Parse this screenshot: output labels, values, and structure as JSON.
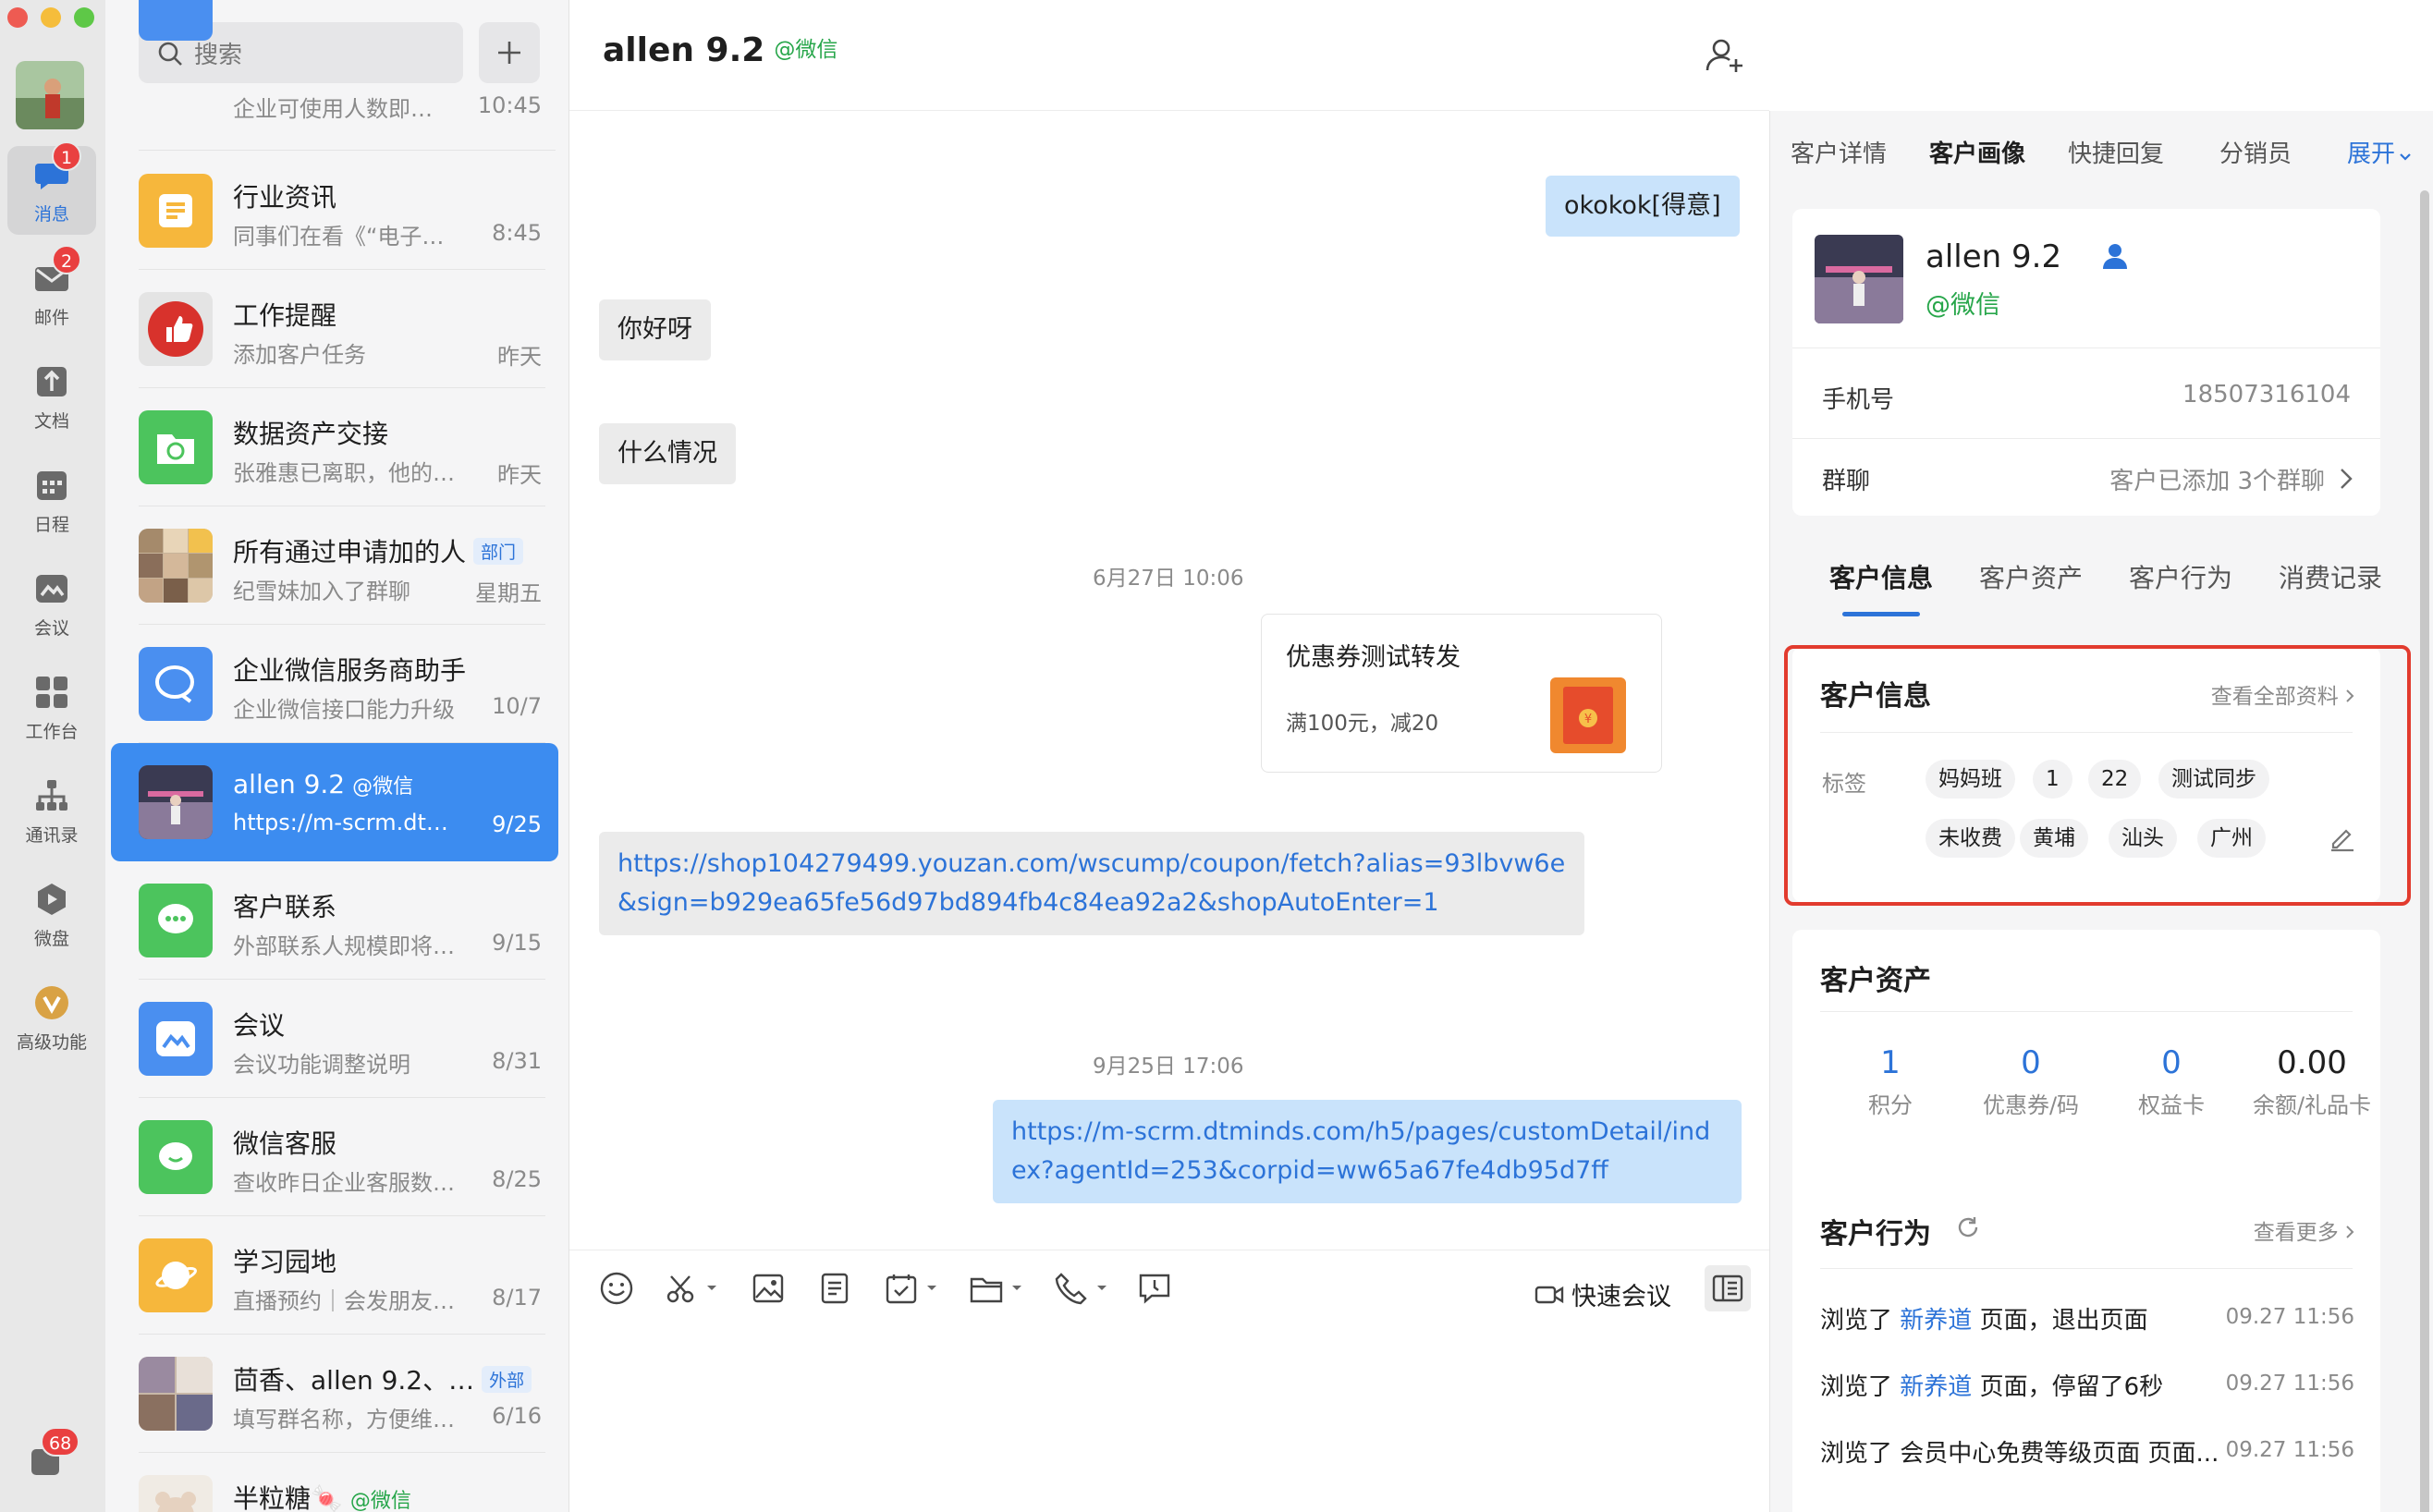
{
  "sidebar": {
    "items": [
      {
        "label": "消息",
        "icon": "chat-bubble-icon",
        "badge": "1"
      },
      {
        "label": "邮件",
        "icon": "mail-icon",
        "badge": "2"
      },
      {
        "label": "文档",
        "icon": "document-icon",
        "badge": ""
      },
      {
        "label": "日程",
        "icon": "calendar-icon",
        "badge": ""
      },
      {
        "label": "会议",
        "icon": "meeting-icon",
        "badge": ""
      },
      {
        "label": "工作台",
        "icon": "workbench-icon",
        "badge": ""
      },
      {
        "label": "通讯录",
        "icon": "contacts-icon",
        "badge": ""
      },
      {
        "label": "微盘",
        "icon": "drive-icon",
        "badge": ""
      },
      {
        "label": "高级功能",
        "icon": "premium-icon",
        "badge": ""
      }
    ],
    "bottom_badge": "68"
  },
  "search": {
    "placeholder": "搜索"
  },
  "conversations": [
    {
      "name": "",
      "preview": "企业可使用人数即…",
      "time": "10:45",
      "color": "#4a8ff0"
    },
    {
      "name": "行业资讯",
      "preview": "同事们在看《“电子…",
      "time": "8:45",
      "color": "#f6b73c"
    },
    {
      "name": "工作提醒",
      "preview": "添加客户任务",
      "time": "昨天",
      "color": "#e0e0e0"
    },
    {
      "name": "数据资产交接",
      "preview": "张雅惠已离职，他的…",
      "time": "昨天",
      "color": "#4cc45d"
    },
    {
      "name": "所有通过申请加的人",
      "tag": "部门",
      "preview": "纪雪妹加入了群聊",
      "time": "星期五",
      "color": "#b89a7a"
    },
    {
      "name": "企业微信服务商助手",
      "preview": "企业微信接口能力升级",
      "time": "10/7",
      "color": "#4a8ff0"
    },
    {
      "name": "allen 9.2",
      "tag_wx": "@微信",
      "preview": "https://m-scrm.dtmi…",
      "time": "9/25",
      "color": "#6b6b8a"
    },
    {
      "name": "客户联系",
      "preview": "外部联系人规模即将…",
      "time": "9/15",
      "color": "#4cc45d"
    },
    {
      "name": "会议",
      "preview": "会议功能调整说明",
      "time": "8/31",
      "color": "#4a8ff0"
    },
    {
      "name": "微信客服",
      "preview": "查收昨日企业客服数…",
      "time": "8/25",
      "color": "#4cc45d"
    },
    {
      "name": "学习园地",
      "preview": "直播预约｜会发朋友…",
      "time": "8/17",
      "color": "#f6b73c"
    },
    {
      "name": "茴香、allen 9.2、…",
      "tag": "外部",
      "preview": "填写群名称，方便维…",
      "time": "6/16",
      "color": "#8a7a6a"
    },
    {
      "name": "半粒糖🍬",
      "tag_wx": "@微信",
      "preview": "",
      "time": "",
      "color": "#e8e0d8"
    }
  ],
  "chat": {
    "title": "allen 9.2",
    "title_tag": "@微信",
    "messages": {
      "m1": "okokok[得意]",
      "m2": "你好呀",
      "m3": "什么情况",
      "t1": "6月27日 10:06",
      "coupon_title": "优惠券测试转发",
      "coupon_desc": "满100元，减20",
      "m4": "https://shop104279499.youzan.com/wscump/coupon/fetch?alias=93lbvw6e&sign=b929ea65fe56d97bd894fb4c84ea92a2&shopAutoEnter=1",
      "t2": "9月25日 17:06",
      "m5": "https://m-scrm.dtminds.com/h5/pages/customDetail/index?agentId=253&corpid=ww65a67fe4db95d7ff"
    },
    "toolbar": {
      "quick_meeting": "快速会议"
    }
  },
  "panel": {
    "tabs": [
      "客户详情",
      "客户画像",
      "快捷回复",
      "分销员"
    ],
    "expand": "展开",
    "profile": {
      "name": "allen 9.2",
      "source": "@微信"
    },
    "phone_label": "手机号",
    "phone_value": "18507316104",
    "group_label": "群聊",
    "group_value": "客户已添加 3个群聊",
    "subtabs": [
      "客户信息",
      "客户资产",
      "客户行为",
      "消费记录"
    ],
    "info": {
      "title": "客户信息",
      "view_all": "查看全部资料",
      "tags_label": "标签",
      "tags_row1": [
        "妈妈班",
        "1",
        "22",
        "测试同步"
      ],
      "tags_row2": [
        "未收费",
        "黄埔",
        "汕头",
        "广州"
      ]
    },
    "assets": {
      "title": "客户资产",
      "items": [
        {
          "value": "1",
          "label": "积分"
        },
        {
          "value": "0",
          "label": "优惠券/码"
        },
        {
          "value": "0",
          "label": "权益卡"
        },
        {
          "value": "0.00",
          "label": "余额/礼品卡"
        }
      ]
    },
    "behavior": {
      "title": "客户行为",
      "more": "查看更多",
      "items": [
        {
          "prefix": "浏览了",
          "highlight": "新养道",
          "suffix": "页面，退出页面",
          "time": "09.27 11:56"
        },
        {
          "prefix": "浏览了",
          "highlight": "新养道",
          "suffix": "页面，停留了6秒",
          "time": "09.27 11:56"
        },
        {
          "prefix": "浏览了",
          "highlight": "",
          "suffix": "会员中心免费等级页面 页面...",
          "time": "09.27 11:56"
        }
      ]
    }
  }
}
